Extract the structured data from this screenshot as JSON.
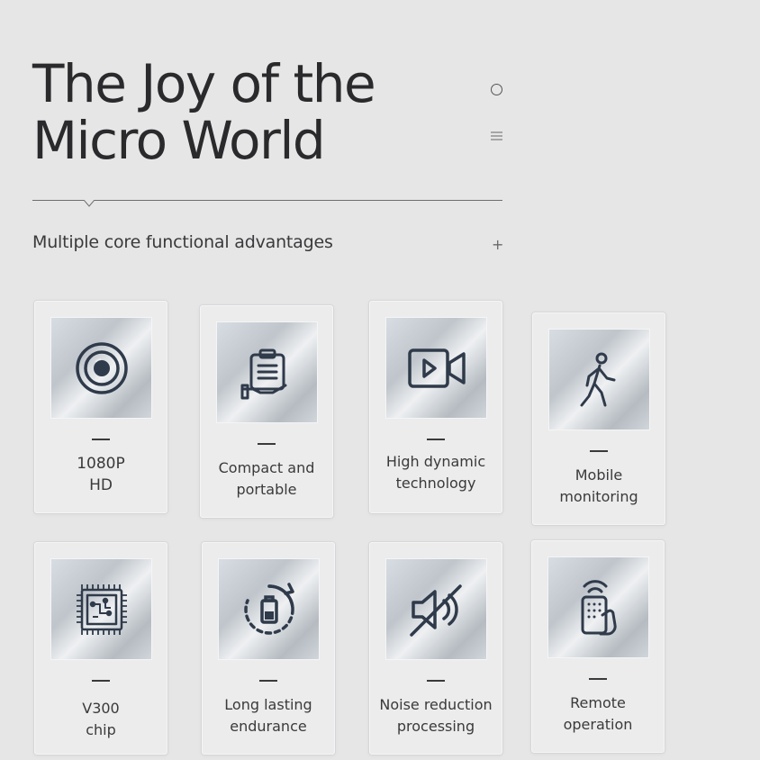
{
  "header": {
    "title_line1": "The Joy of the",
    "title_line2": "Micro World",
    "subtitle": "Multiple core functional advantages",
    "plus_symbol": "+"
  },
  "features": [
    {
      "line1": "1080P",
      "line2": "HD",
      "icon": "camera-lens-icon"
    },
    {
      "line1": "Compact and",
      "line2": "portable",
      "icon": "hand-holding-clipboard-icon"
    },
    {
      "line1": "High dynamic",
      "line2": "technology",
      "icon": "video-camera-icon"
    },
    {
      "line1": "Mobile",
      "line2": "monitoring",
      "icon": "walking-person-icon"
    },
    {
      "line1": "V300",
      "line2": "chip",
      "icon": "chip-icon"
    },
    {
      "line1": "Long lasting",
      "line2": "endurance",
      "icon": "battery-recycle-icon"
    },
    {
      "line1": "Noise reduction",
      "line2": "processing",
      "icon": "speaker-muted-icon"
    },
    {
      "line1": "Remote",
      "line2": "operation",
      "icon": "remote-control-icon"
    }
  ],
  "colors": {
    "background": "#e6e6e7",
    "text": "#2a2a2c",
    "icon_stroke": "#2f3a4a"
  }
}
